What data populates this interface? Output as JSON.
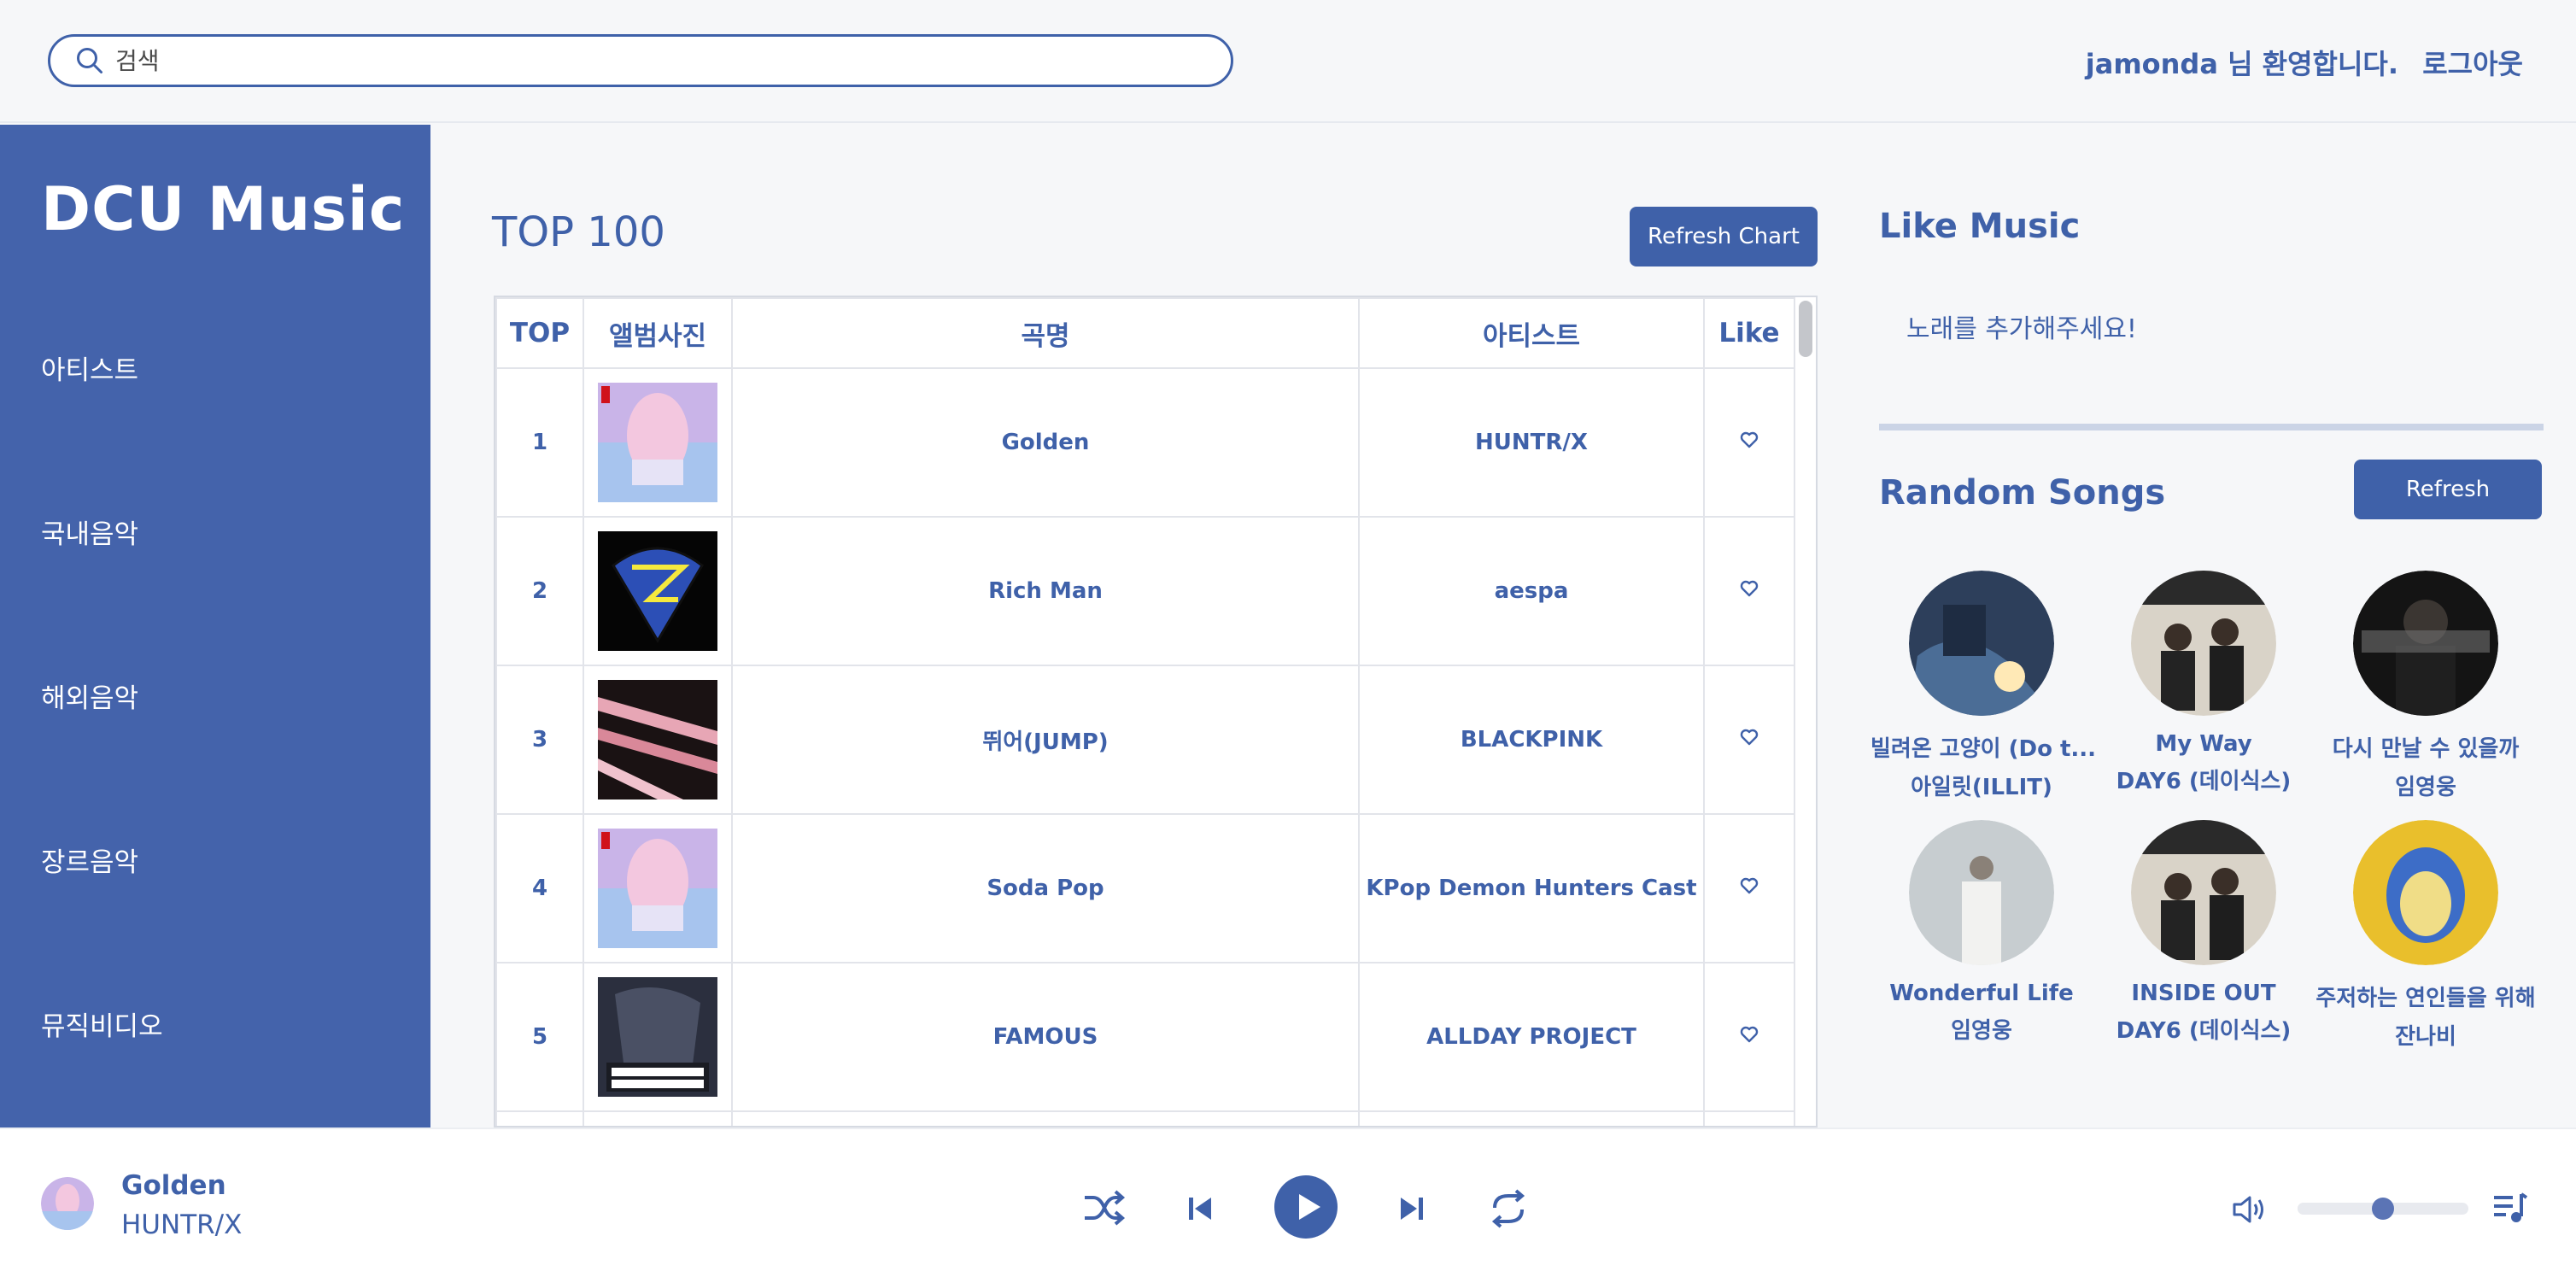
{
  "header": {
    "search_placeholder": "검색",
    "welcome_user": "jamonda",
    "welcome_suffix": " 님 환영합니다.",
    "logout": "로그아웃"
  },
  "sidebar": {
    "logo": "DCU Music",
    "items": [
      {
        "label": "아티스트"
      },
      {
        "label": "국내음악"
      },
      {
        "label": "해외음악"
      },
      {
        "label": "장르음악"
      },
      {
        "label": "뮤직비디오"
      }
    ]
  },
  "chart": {
    "title": "TOP 100",
    "refresh_label": "Refresh Chart",
    "columns": [
      "TOP",
      "앨범사진",
      "곡명",
      "아티스트",
      "Like"
    ],
    "rows": [
      {
        "rank": "1",
        "title": "Golden",
        "artist": "HUNTR/X"
      },
      {
        "rank": "2",
        "title": "Rich Man",
        "artist": "aespa"
      },
      {
        "rank": "3",
        "title": "뛰어(JUMP)",
        "artist": "BLACKPINK"
      },
      {
        "rank": "4",
        "title": "Soda Pop",
        "artist": "KPop Demon Hunters Cast"
      },
      {
        "rank": "5",
        "title": "FAMOUS",
        "artist": "ALLDAY PROJECT"
      }
    ]
  },
  "like_music": {
    "title": "Like Music",
    "empty_text": "노래를 추가해주세요!"
  },
  "random_songs": {
    "title": "Random Songs",
    "refresh_label": "Refresh",
    "songs": [
      {
        "title": "빌려온 고양이 (Do t...",
        "artist": "아일릿(ILLIT)"
      },
      {
        "title": "My Way",
        "artist": "DAY6 (데이식스)"
      },
      {
        "title": "다시 만날 수 있을까",
        "artist": "임영웅"
      },
      {
        "title": "Wonderful Life",
        "artist": "임영웅"
      },
      {
        "title": "INSIDE OUT",
        "artist": "DAY6 (데이식스)"
      },
      {
        "title": "주저하는 연인들을 위해",
        "artist": "잔나비"
      }
    ]
  },
  "player": {
    "title": "Golden",
    "artist": "HUNTR/X",
    "volume": 0.5
  },
  "colors": {
    "accent": "#3f61a9",
    "sidebar": "#4463ab"
  }
}
